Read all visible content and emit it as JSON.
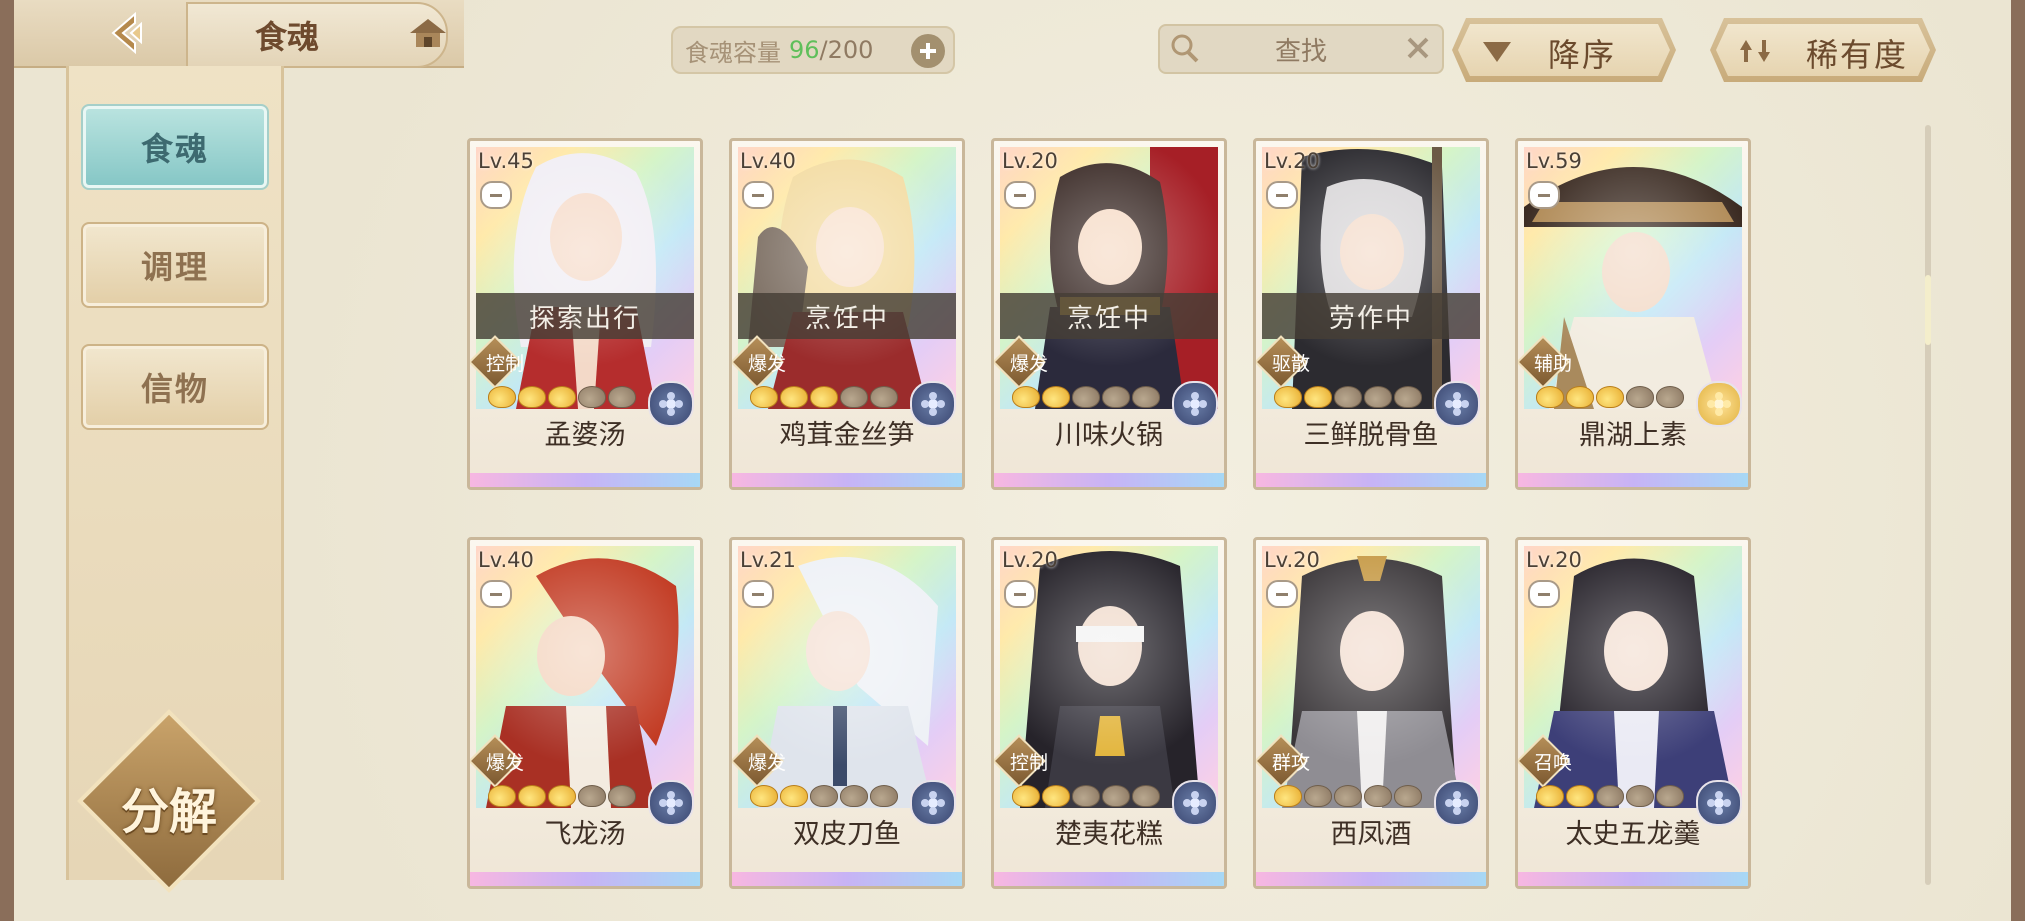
{
  "header": {
    "title": "食魂",
    "capacity_label": "食魂容量",
    "capacity_current": "96",
    "capacity_separator": "/",
    "capacity_max": "200",
    "search_label": "查找",
    "sort_order_label": "降序",
    "sort_key_label": "稀有度"
  },
  "sidebar": {
    "tabs": [
      {
        "label": "食魂",
        "active": true
      },
      {
        "label": "调理",
        "active": false
      },
      {
        "label": "信物",
        "active": false
      }
    ],
    "decompose_label": "分解"
  },
  "cards": [
    {
      "level": "Lv.45",
      "name": "孟婆汤",
      "status": "探索出行",
      "role": "控制",
      "stars": 3,
      "flower": "blue"
    },
    {
      "level": "Lv.40",
      "name": "鸡茸金丝笋",
      "status": "烹饪中",
      "role": "爆发",
      "stars": 3,
      "flower": "blue"
    },
    {
      "level": "Lv.20",
      "name": "川味火锅",
      "status": "烹饪中",
      "role": "爆发",
      "stars": 2,
      "flower": "blue"
    },
    {
      "level": "Lv.20",
      "name": "三鲜脱骨鱼",
      "status": "劳作中",
      "role": "驱散",
      "stars": 2,
      "flower": "blue"
    },
    {
      "level": "Lv.59",
      "name": "鼎湖上素",
      "status": "",
      "role": "辅助",
      "stars": 3,
      "flower": "gold"
    },
    {
      "level": "Lv.40",
      "name": "飞龙汤",
      "status": "",
      "role": "爆发",
      "stars": 3,
      "flower": "blue"
    },
    {
      "level": "Lv.21",
      "name": "双皮刀鱼",
      "status": "",
      "role": "爆发",
      "stars": 2,
      "flower": "blue"
    },
    {
      "level": "Lv.20",
      "name": "楚夷花糕",
      "status": "",
      "role": "控制",
      "stars": 2,
      "flower": "blue"
    },
    {
      "level": "Lv.20",
      "name": "西凤酒",
      "status": "",
      "role": "群攻",
      "stars": 1,
      "flower": "blue"
    },
    {
      "level": "Lv.20",
      "name": "太史五龙羹",
      "status": "",
      "role": "召唤",
      "stars": 2,
      "flower": "blue"
    }
  ],
  "colors": {
    "accent_teal": "#86c7c6",
    "gold": "#c9a36a",
    "capacity_green": "#5fbf5a"
  }
}
